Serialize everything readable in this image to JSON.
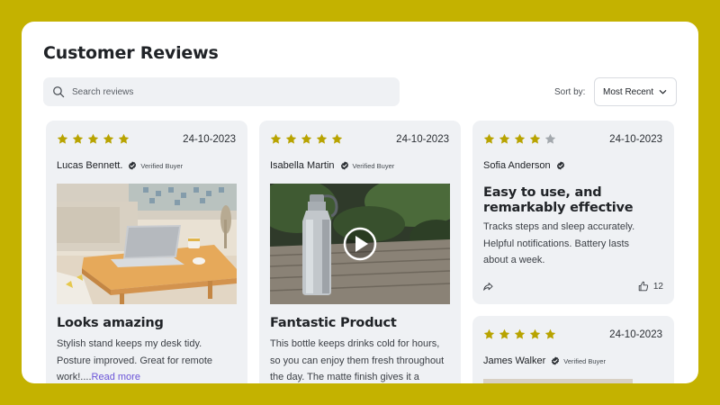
{
  "header": {
    "title": "Customer Reviews"
  },
  "search": {
    "placeholder": "Search reviews",
    "icon": "search-icon"
  },
  "sort": {
    "label": "Sort by:",
    "selected": "Most Recent",
    "icon": "chevron-down-icon"
  },
  "colors": {
    "frame": "#c4b200",
    "star_filled": "#b8a300",
    "star_empty": "#a3a8ad",
    "card_bg": "#eff1f4",
    "link": "#6b55d8"
  },
  "reviews": [
    {
      "rating": 5,
      "date": "24-10-2023",
      "name": "Lucas Bennett.",
      "badge": "Verified Buyer",
      "media": "image-laptop-on-wooden-stand",
      "title": "Looks amazing",
      "body": [
        "Stylish stand keeps my desk tidy.",
        "Posture improved. Great for remote",
        "work!...."
      ],
      "read_more": "Read more"
    },
    {
      "rating": 5,
      "date": "24-10-2023",
      "name": "Isabella Martin",
      "badge": "Verified Buyer",
      "media": "video-water-bottle",
      "title": "Fantastic Product",
      "body": [
        "This bottle keeps drinks cold for hours,",
        "so you can enjoy them fresh throughout",
        "the day. The matte finish gives it a"
      ]
    },
    {
      "rating": 4,
      "date": "24-10-2023",
      "name": "Sofia Anderson",
      "title": "Easy to use, and remarkably effective",
      "body": [
        "Tracks steps and sleep accurately.",
        "Helpful notifications. Battery lasts",
        "about a week."
      ],
      "likes": "12"
    },
    {
      "rating": 5,
      "date": "24-10-2023",
      "name": "James Walker",
      "badge": "Verified Buyer"
    }
  ]
}
